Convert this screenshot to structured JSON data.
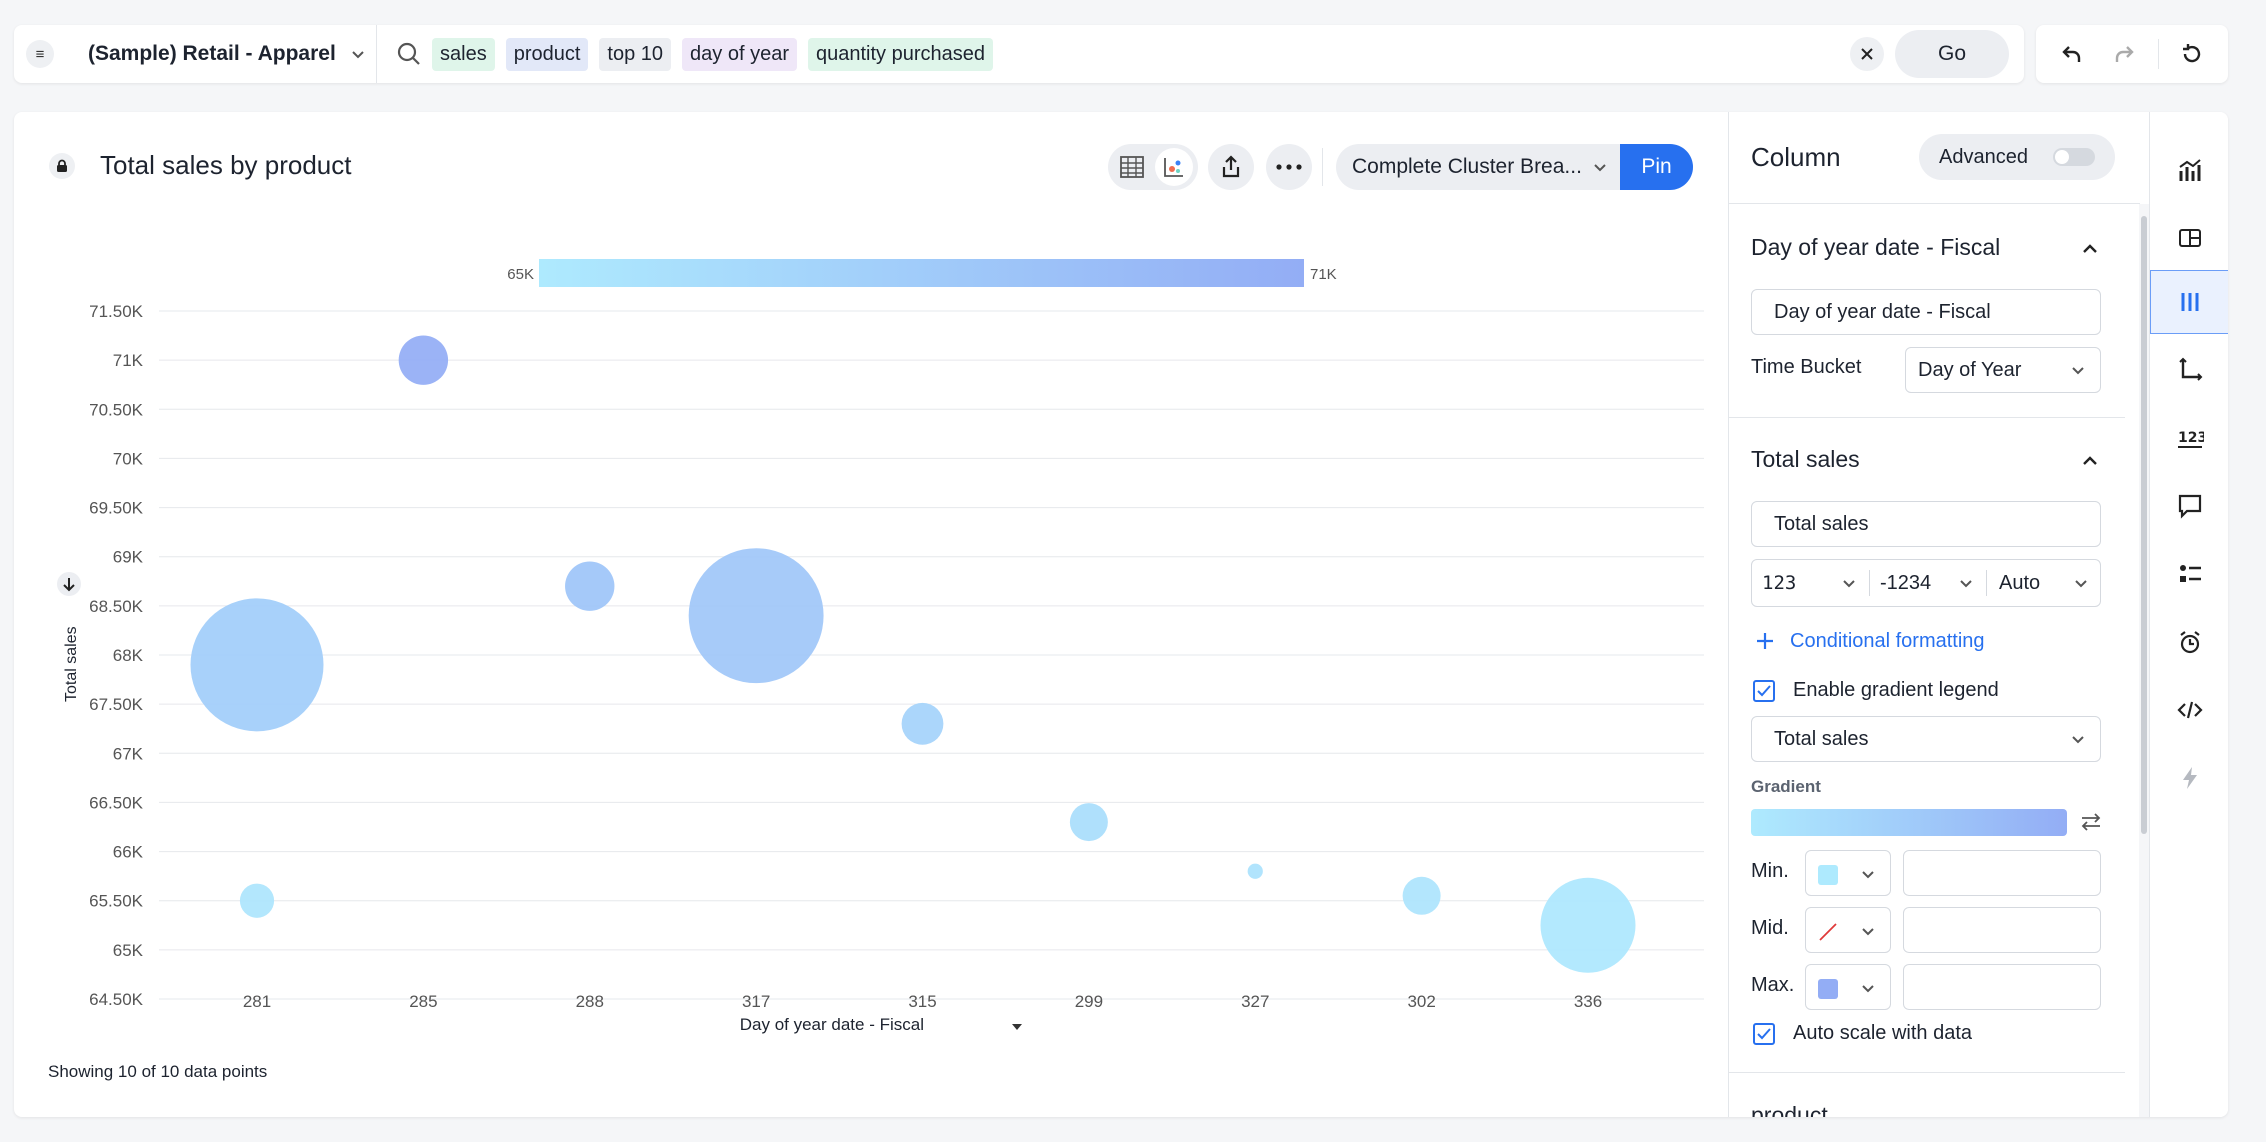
{
  "search": {
    "datasource": "(Sample) Retail - Apparel",
    "tokens": [
      {
        "label": "sales",
        "kind": "measure"
      },
      {
        "label": "product",
        "kind": "attribute"
      },
      {
        "label": "top 10",
        "kind": "keyword"
      },
      {
        "label": "day of year",
        "kind": "date"
      },
      {
        "label": "quantity purchased",
        "kind": "measure"
      }
    ],
    "go_label": "Go"
  },
  "answer": {
    "title": "Total sales by product",
    "cluster_label": "Complete Cluster Brea...",
    "pin_label": "Pin",
    "footnote": "Showing 10 of 10 data points"
  },
  "panel": {
    "title": "Column",
    "advanced_label": "Advanced",
    "section1": {
      "title": "Day of year date - Fiscal",
      "name_value": "Day of year date - Fiscal",
      "time_bucket_label": "Time Bucket",
      "time_bucket_value": "Day of Year"
    },
    "section2": {
      "title": "Total sales",
      "name_value": "Total sales",
      "format_type": "123",
      "format_negative": "-1234",
      "format_units": "Auto",
      "conditional_formatting": "Conditional formatting",
      "enable_gradient_legend": "Enable gradient legend",
      "gradient_column": "Total sales",
      "gradient_label": "Gradient",
      "min_label": "Min.",
      "mid_label": "Mid.",
      "max_label": "Max.",
      "auto_scale": "Auto scale with data"
    },
    "section3_title": "product"
  },
  "colors": {
    "accent": "#2770ef",
    "gradient_min": "#aeeafe",
    "gradient_max": "#93adf5"
  },
  "chart_data": {
    "type": "scatter",
    "subtype": "bubble",
    "xlabel": "Day of year date - Fiscal",
    "ylabel": "Total sales",
    "categories": [
      "281",
      "285",
      "288",
      "317",
      "315",
      "299",
      "327",
      "302",
      "336"
    ],
    "y_ticks": [
      "71.50K",
      "71K",
      "70.50K",
      "70K",
      "69.50K",
      "69K",
      "68.50K",
      "68K",
      "67.50K",
      "67K",
      "66.50K",
      "66K",
      "65.50K",
      "65K",
      "64.50K"
    ],
    "ylim": [
      64500,
      71500
    ],
    "legend": {
      "type": "gradient",
      "min_label": "65K",
      "max_label": "71K",
      "min": 65000,
      "max": 71000
    },
    "points": [
      {
        "x": "281",
        "y": 67900,
        "size": 7.0
      },
      {
        "x": "281",
        "y": 65500,
        "size": 1.8
      },
      {
        "x": "285",
        "y": 71000,
        "size": 2.6
      },
      {
        "x": "288",
        "y": 68700,
        "size": 2.6
      },
      {
        "x": "317",
        "y": 68400,
        "size": 7.1
      },
      {
        "x": "315",
        "y": 67300,
        "size": 2.2
      },
      {
        "x": "299",
        "y": 66300,
        "size": 2.0
      },
      {
        "x": "327",
        "y": 65800,
        "size": 0.8
      },
      {
        "x": "302",
        "y": 65550,
        "size": 2.0
      },
      {
        "x": "336",
        "y": 65250,
        "size": 5.0
      }
    ],
    "grid": true
  }
}
